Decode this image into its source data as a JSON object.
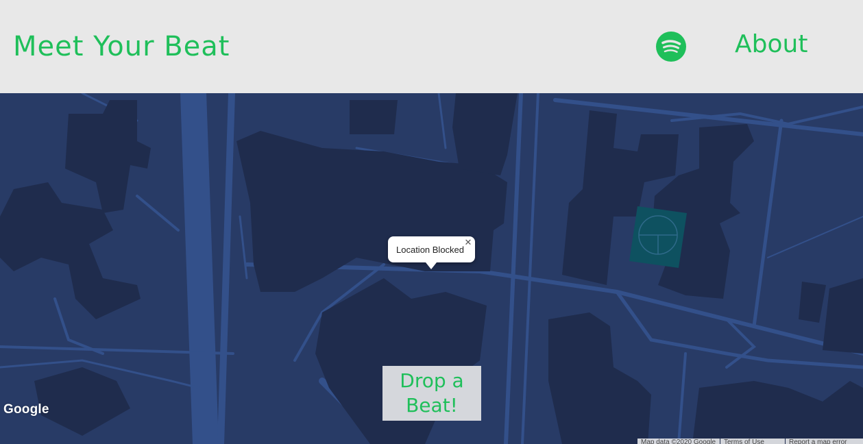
{
  "header": {
    "brand": "Meet Your Beat",
    "about_label": "About"
  },
  "icons": {
    "spotify": "spotify-icon",
    "close": "close-icon"
  },
  "colors": {
    "accent_green": "#1fbf5a",
    "header_bg": "#e8e8e8",
    "map_bg": "#283b66",
    "building": "#1f2c4d",
    "road": "#33508a",
    "park": "#0e5160",
    "button_bg": "#d5d7dc"
  },
  "map": {
    "info_window": {
      "text": "Location Blocked"
    },
    "drop_button": {
      "line1": "Drop a",
      "line2": "Beat!"
    },
    "google_logo": "Google",
    "attribution": {
      "map_data": "Map data ©2020 Google",
      "terms": "Terms of Use",
      "report": "Report a map error"
    }
  }
}
